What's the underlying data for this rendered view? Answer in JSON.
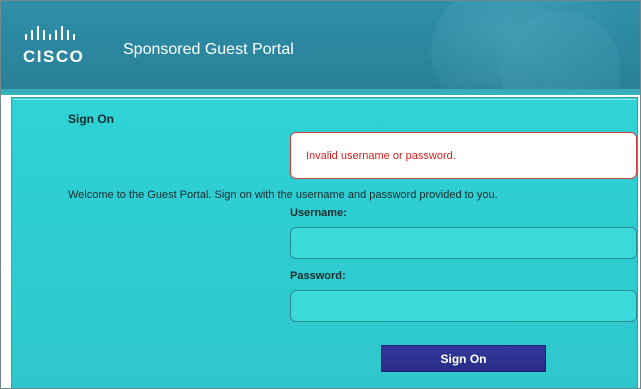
{
  "header": {
    "logo_word": "CISCO",
    "portal_title": "Sponsored Guest Portal",
    "logo_icon": "cisco-bridge-logo"
  },
  "form": {
    "heading": "Sign On",
    "error_message": "Invalid username or password.",
    "welcome_text": "Welcome to the Guest Portal. Sign on with the username and password provided to you.",
    "username_label": "Username:",
    "username_value": "",
    "password_label": "Password:",
    "password_value": "",
    "submit_label": "Sign On"
  },
  "colors": {
    "header_bg": "#2b879f",
    "panel_bg": "#2fd3d6",
    "error_border": "#d23c3c",
    "error_text": "#d42020",
    "button_bg": "#2c3190"
  }
}
